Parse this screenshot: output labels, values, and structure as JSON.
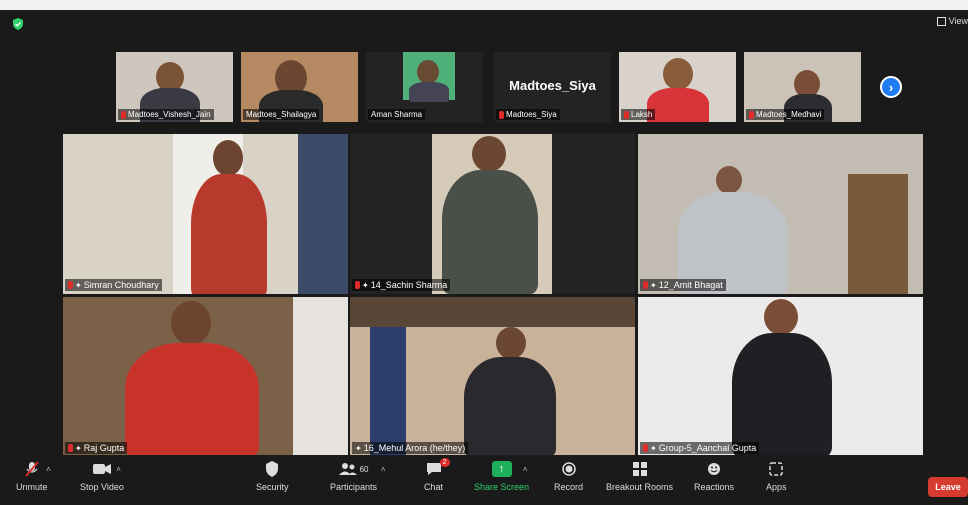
{
  "top_bar": {
    "view_label": "View"
  },
  "gallery": {
    "thumbnails": [
      {
        "name": "Madtoes_Vishesh_Jain",
        "muted": true
      },
      {
        "name": "Madtoes_Shailagya",
        "muted": false
      },
      {
        "name": "Aman Sharma",
        "muted": false
      },
      {
        "name": "Madtoes_Siya",
        "muted": true,
        "display_name": "Madtoes_Siya"
      },
      {
        "name": "Laksh",
        "muted": true
      },
      {
        "name": "Madtoes_Medhavi",
        "muted": true
      }
    ],
    "tiles": [
      {
        "name": "Simran Choudhary",
        "muted": true
      },
      {
        "name": "14_Sachin Sharma",
        "muted": true
      },
      {
        "name": "12_Amit Bhagat",
        "muted": true
      },
      {
        "name": "Raj Gupta",
        "muted": true
      },
      {
        "name": "16_Mehul Arora (he/they)",
        "muted": false
      },
      {
        "name": "Group-5_Aanchal Gupta",
        "muted": true
      }
    ]
  },
  "toolbar": {
    "unmute": "Unmute",
    "stop_video": "Stop Video",
    "security": "Security",
    "participants": "Participants",
    "participants_count": "60",
    "chat": "Chat",
    "chat_badge": "2",
    "share_screen": "Share Screen",
    "record": "Record",
    "breakout_rooms": "Breakout Rooms",
    "reactions": "Reactions",
    "apps": "Apps",
    "leave": "Leave"
  },
  "colors": {
    "share_green": "#2fd16b",
    "leave_red": "#d63b2f",
    "accent_blue": "#1e7cf0",
    "muted_red": "#e02b2b"
  }
}
